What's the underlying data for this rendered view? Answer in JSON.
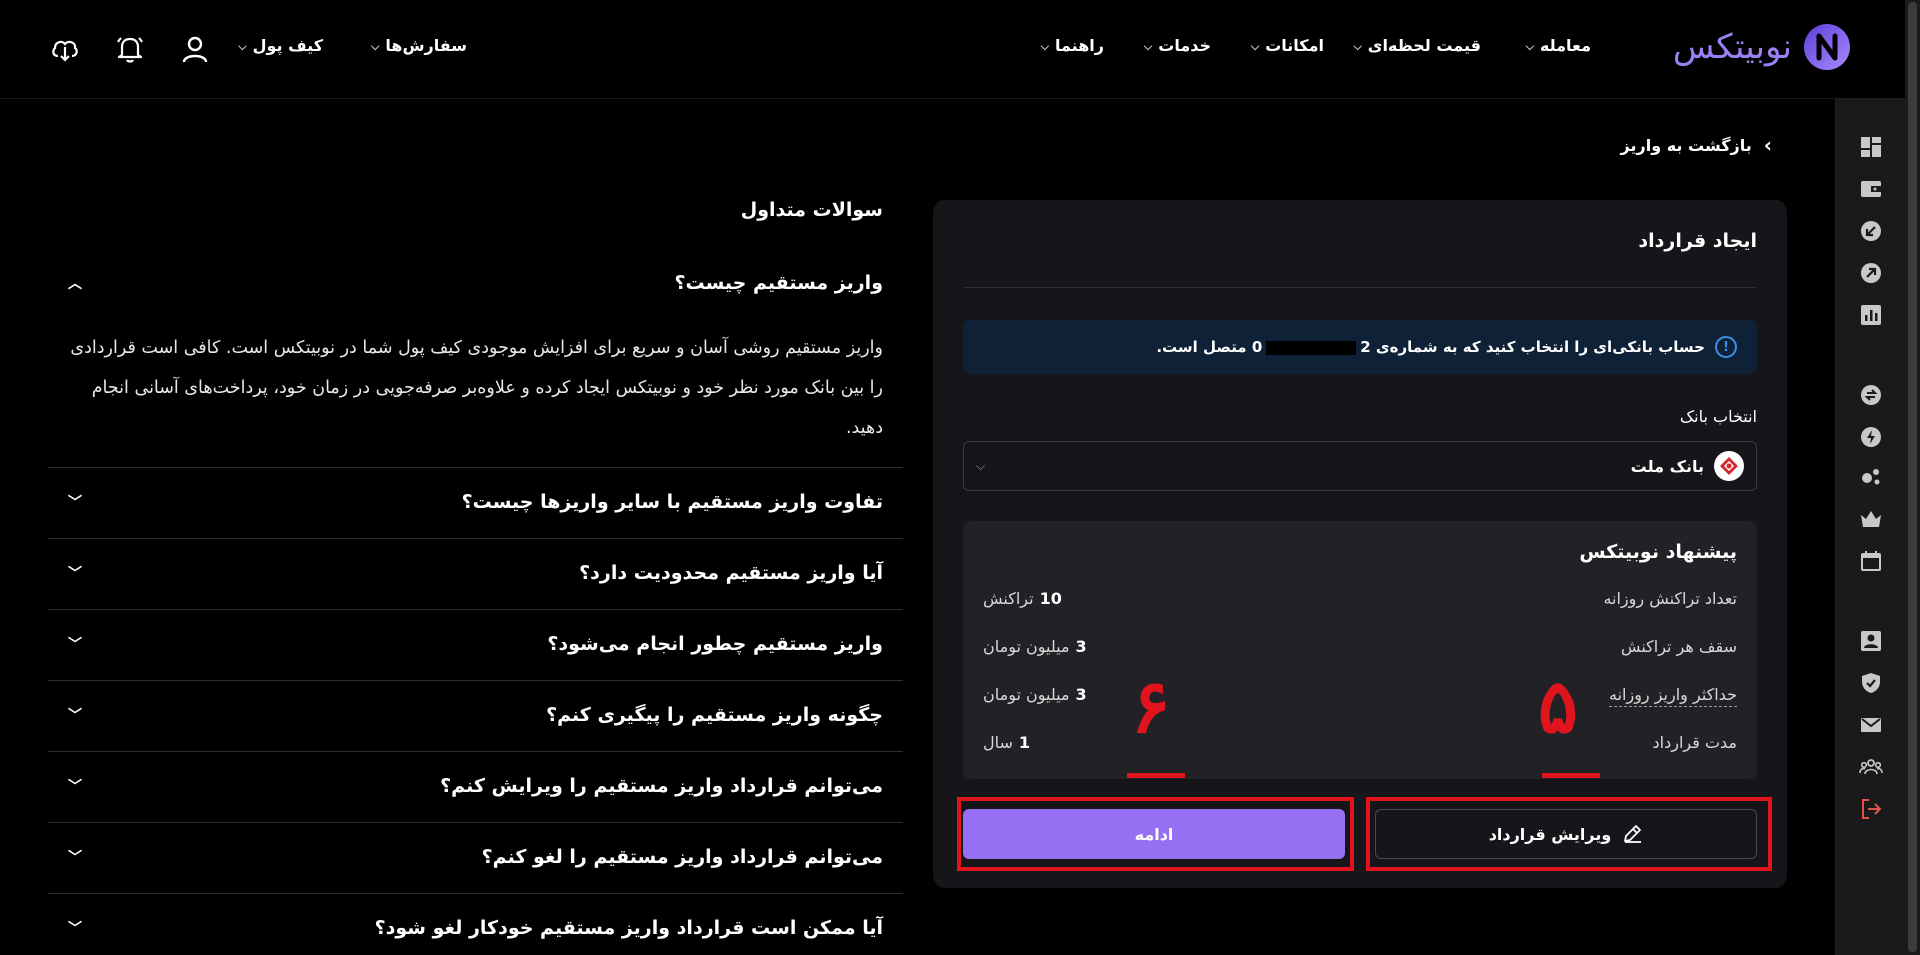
{
  "header": {
    "logo_text": "نوبیتکس",
    "nav": [
      {
        "label": "معامله"
      },
      {
        "label": "قیمت لحظه‌ای"
      },
      {
        "label": "امکانات"
      },
      {
        "label": "خدمات"
      },
      {
        "label": "راهنما"
      }
    ],
    "left_nav": [
      {
        "label": "سفارش‌ها"
      },
      {
        "label": "کیف پول"
      }
    ],
    "icons": [
      "profile-icon",
      "notification-bell-icon",
      "download-app-icon"
    ]
  },
  "sidebar": {
    "icons": [
      "dashboard-icon",
      "wallet-icon",
      "deposit-icon",
      "withdraw-icon",
      "report-icon",
      "exchange-icon",
      "lightning-icon",
      "social-icon",
      "crown-icon",
      "calendar-icon",
      "profile-card-icon",
      "shield-check-icon",
      "mail-icon",
      "referral-icon",
      "logout-icon"
    ],
    "logout_color": "#e0524a"
  },
  "back": {
    "label": "بازگشت به واریز"
  },
  "contract": {
    "title": "ایجاد قرارداد",
    "info_prefix": "حساب بانکی‌ای را انتخاب کنید که به شماره‌ی 2",
    "info_suffix": "0 متصل است.",
    "bank_label": "انتخاب بانک",
    "bank_name": "بانک ملت",
    "offer": {
      "title": "پیشنهاد نوبیتکس",
      "rows": [
        {
          "label": "تعداد تراکنش روزانه",
          "value": "10",
          "unit": "تراکنش"
        },
        {
          "label": "سقف هر تراکنش",
          "value": "3",
          "unit": "میلیون تومان"
        },
        {
          "label": "حداکثر واریز روزانه",
          "value": "3",
          "unit": "میلیون تومان"
        },
        {
          "label": "مدت قرارداد",
          "value": "1",
          "unit": "سال"
        }
      ]
    },
    "edit_button": "ویرایش قرارداد",
    "continue_button": "ادامه",
    "annotation_left": "۶",
    "annotation_right": "۵",
    "accent": "#9570f2",
    "highlight": "#e0141d"
  },
  "faq": {
    "title": "سوالات متداول",
    "items": [
      {
        "q": "واریز مستقیم چیست؟",
        "open": true
      },
      {
        "q": "تفاوت واریز مستقیم با سایر واریزها چیست؟"
      },
      {
        "q": "آیا واریز مستقیم محدودیت دارد؟"
      },
      {
        "q": "واریز مستقیم چطور انجام می‌شود؟"
      },
      {
        "q": "چگونه واریز مستقیم را پیگیری کنم؟"
      },
      {
        "q": "می‌توانم قرارداد واریز مستقیم را ویرایش کنم؟"
      },
      {
        "q": "می‌توانم قرارداد واریز مستقیم را لغو کنم؟"
      },
      {
        "q": "آیا ممکن است قرارداد واریز مستقیم خودکار لغو شود؟"
      }
    ],
    "answer": "واریز مستقیم روشی آسان و سریع برای افزایش موجودی کیف پول شما در نوبیتکس است. کافی است قراردادی را بین بانک مورد نظر خود و نوبیتکس ایجاد کرده و علاوه‌بر صرفه‌جویی در زمان خود، پرداخت‌های آسانی انجام دهید."
  }
}
